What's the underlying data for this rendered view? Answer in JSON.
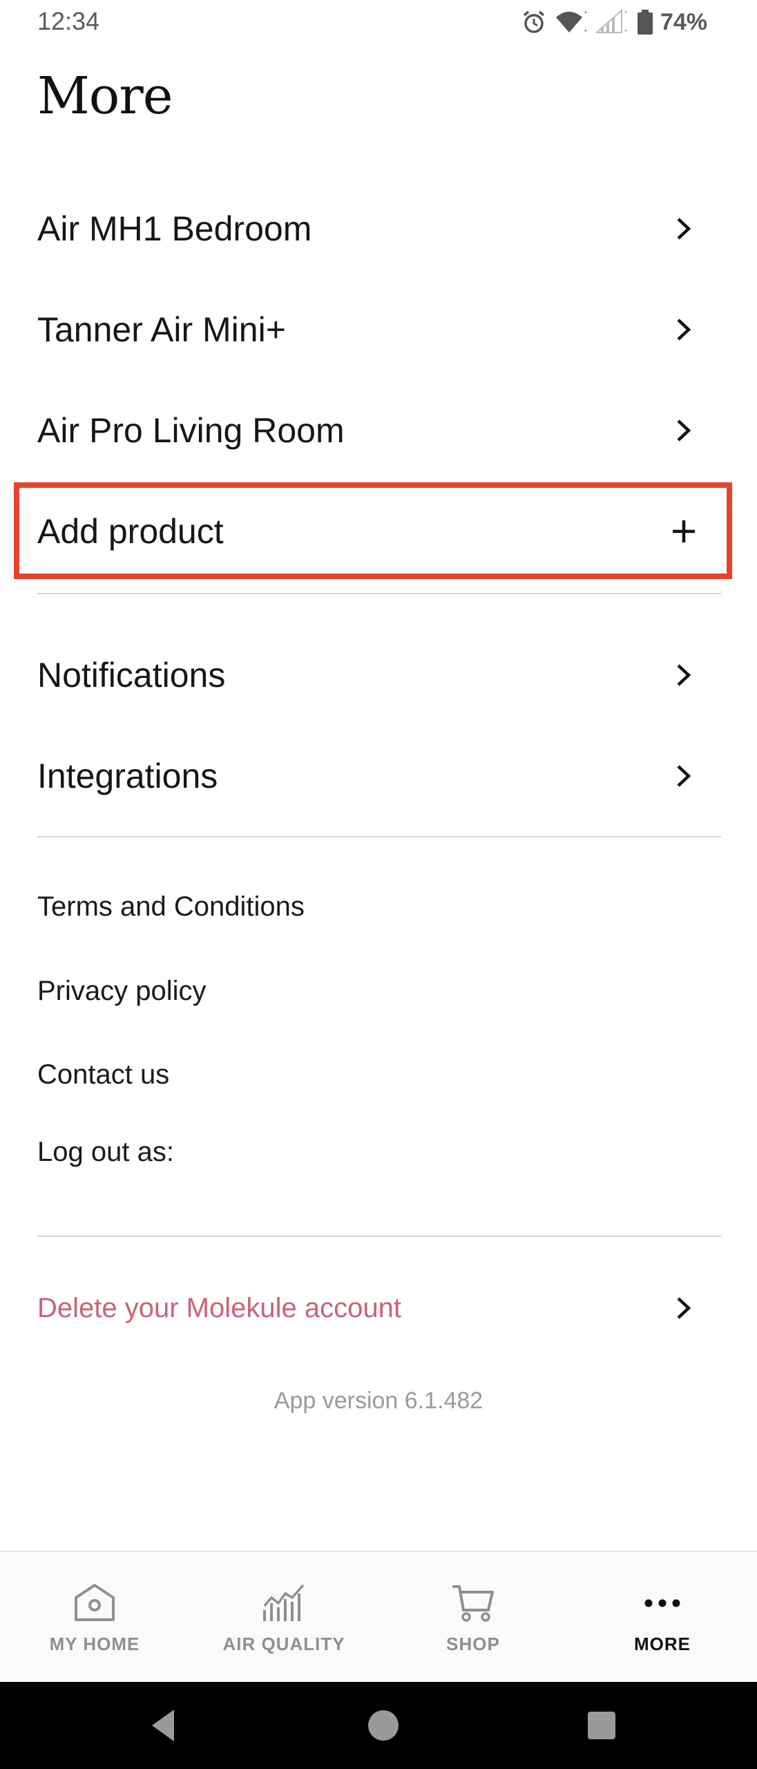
{
  "status": {
    "time": "12:34",
    "battery": "74%"
  },
  "page": {
    "title": "More"
  },
  "products": [
    {
      "label": "Air MH1 Bedroom",
      "icon": "chevron-right-icon"
    },
    {
      "label": "Tanner Air Mini+",
      "icon": "chevron-right-icon"
    },
    {
      "label": "Air Pro Living Room",
      "icon": "chevron-right-icon"
    }
  ],
  "add_product": {
    "label": "Add product",
    "icon": "plus-icon"
  },
  "settings": [
    {
      "label": "Notifications",
      "icon": "chevron-right-icon"
    },
    {
      "label": "Integrations",
      "icon": "chevron-right-icon"
    }
  ],
  "links": {
    "terms": "Terms and Conditions",
    "privacy": "Privacy policy",
    "contact": "Contact us",
    "logout": "Log out as:"
  },
  "delete_account": {
    "label": "Delete your Molekule account",
    "color": "#c96377"
  },
  "version": "App version 6.1.482",
  "tabs": [
    {
      "label": "MY HOME",
      "icon": "home-icon"
    },
    {
      "label": "AIR QUALITY",
      "icon": "air-quality-chart-icon"
    },
    {
      "label": "SHOP",
      "icon": "cart-icon"
    },
    {
      "label": "MORE",
      "icon": "more-dots-icon",
      "active": true
    }
  ],
  "colors": {
    "highlight": "#e8412c",
    "text": "#161616",
    "inactive_tab": "#8f8f8f"
  }
}
